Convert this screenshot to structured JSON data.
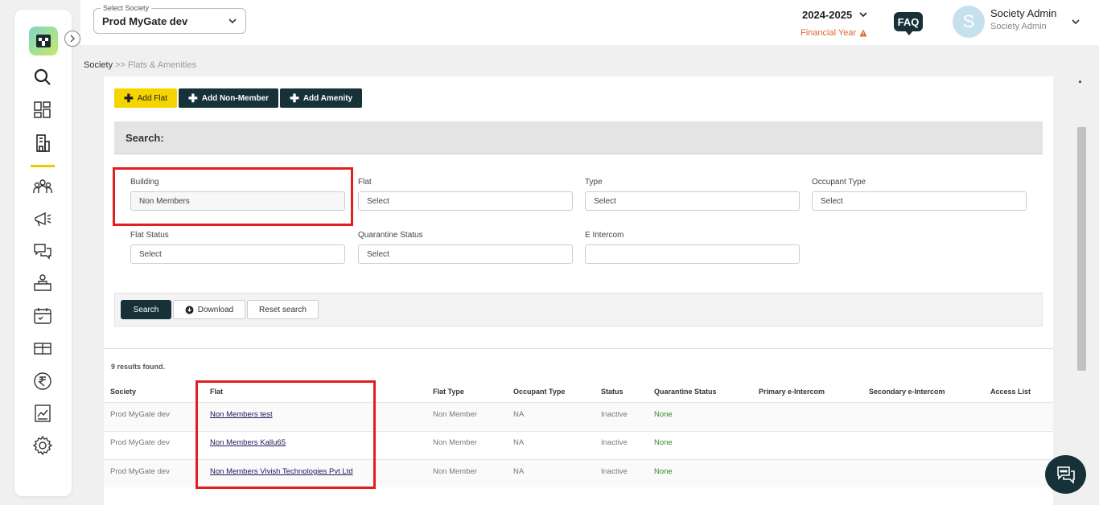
{
  "header": {
    "society_label": "Select Society",
    "society_value": "Prod MyGate dev",
    "year": "2024-2025",
    "financial_year_label": "Financial Year",
    "faq_label": "FAQ",
    "avatar_letter": "S",
    "user_name": "Society Admin",
    "user_role": "Society Admin"
  },
  "sidebar": {
    "items": [
      "search-icon",
      "dashboard-icon",
      "building-icon",
      "members-icon",
      "notice-icon",
      "helpdesk-icon",
      "staff-icon",
      "calendar-icon",
      "amenity-icon",
      "rupee-icon",
      "reports-icon",
      "settings-icon"
    ],
    "active": "building-icon"
  },
  "breadcrumb": {
    "root": "Society",
    "separator": " >> ",
    "current": "Flats & Amenities"
  },
  "toolbar": {
    "add_flat": "Add Flat",
    "add_non_member": "Add Non-Member",
    "add_amenity": "Add Amenity"
  },
  "search": {
    "title": "Search:",
    "fields": {
      "building": {
        "label": "Building",
        "value": "Non Members"
      },
      "flat": {
        "label": "Flat",
        "value": "Select"
      },
      "type": {
        "label": "Type",
        "value": "Select"
      },
      "occupant_type": {
        "label": "Occupant Type",
        "value": "Select"
      },
      "flat_status": {
        "label": "Flat Status",
        "value": "Select"
      },
      "quarantine_status": {
        "label": "Quarantine Status",
        "value": "Select"
      },
      "e_intercom": {
        "label": "E Intercom",
        "value": ""
      }
    },
    "search_button": "Search",
    "download_button": "Download",
    "reset_button": "Reset search"
  },
  "results": {
    "count_text": "9 results found.",
    "columns": [
      "Society",
      "Flat",
      "Flat Type",
      "Occupant Type",
      "Status",
      "Quarantine Status",
      "Primary e-Intercom",
      "Secondary e-Intercom",
      "Access List"
    ],
    "rows": [
      {
        "society": "Prod MyGate dev",
        "flat": "Non Members test",
        "flat_type": "Non Member",
        "occupant_type": "NA",
        "status": "Inactive",
        "quarantine": "None"
      },
      {
        "society": "Prod MyGate dev",
        "flat": "Non Members Kallu65",
        "flat_type": "Non Member",
        "occupant_type": "NA",
        "status": "Inactive",
        "quarantine": "None"
      },
      {
        "society": "Prod MyGate dev",
        "flat": "Non Members Vivish Technologies Pvt Ltd",
        "flat_type": "Non Member",
        "occupant_type": "NA",
        "status": "Inactive",
        "quarantine": "None"
      }
    ]
  },
  "colors": {
    "brand_dark": "#163238",
    "accent_yellow": "#f5d400",
    "highlight_red": "#e02020",
    "warning_orange": "#e0662d",
    "status_green": "#2e8b2e"
  }
}
